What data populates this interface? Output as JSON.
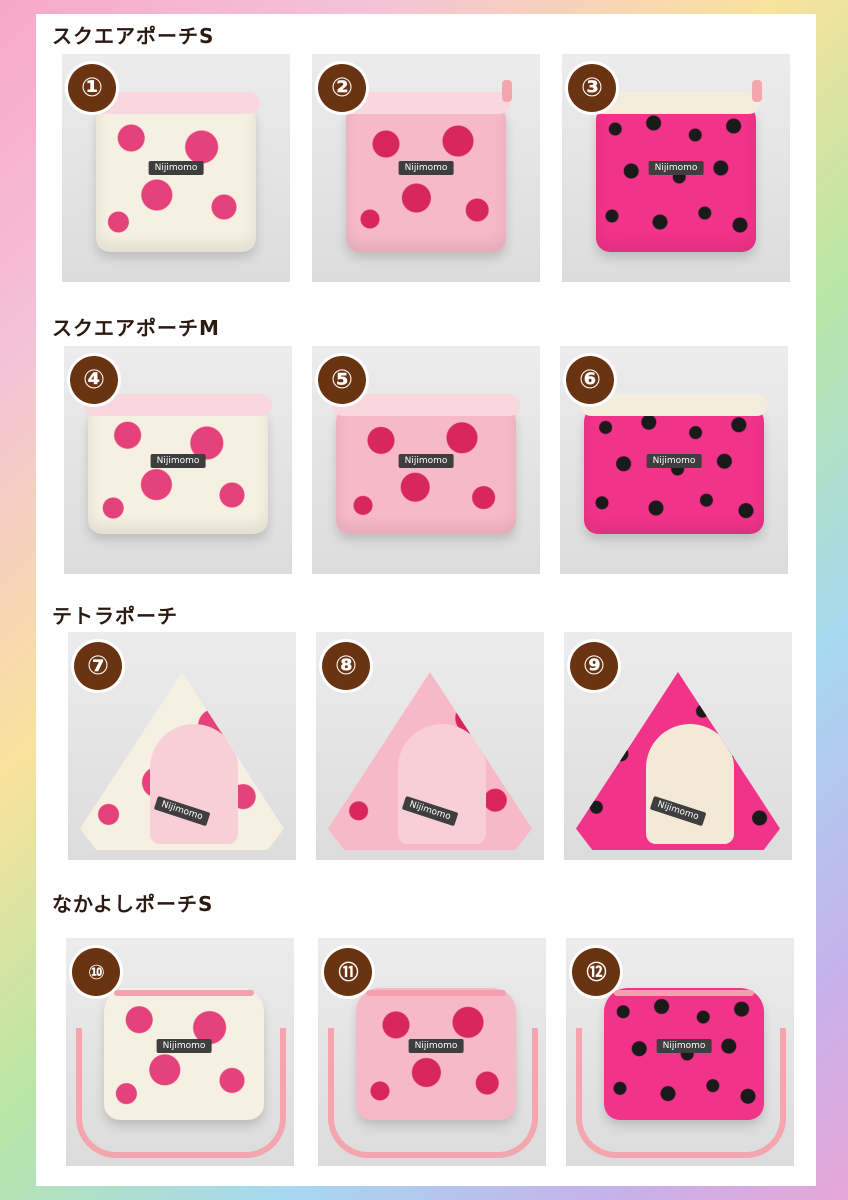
{
  "sections": [
    {
      "title": "スクエアポーチS",
      "items": [
        "①",
        "②",
        "③"
      ]
    },
    {
      "title": "スクエアポーチM",
      "items": [
        "④",
        "⑤",
        "⑥"
      ]
    },
    {
      "title": "テトラポーチ",
      "items": [
        "⑦",
        "⑧",
        "⑨"
      ]
    },
    {
      "title": "なかよしポーチS",
      "items": [
        "⑩",
        "⑪",
        "⑫"
      ]
    }
  ],
  "bag_label": "Nijimomo",
  "colors": {
    "badge": "#6a3412",
    "cream_heart": "#e5427c",
    "pink_heart": "#d8275a",
    "hot_pink_leopard": "#f2338a"
  },
  "patterns": [
    "cream-pink-hearts",
    "pink-red-hearts",
    "hot-pink-black-spots"
  ]
}
